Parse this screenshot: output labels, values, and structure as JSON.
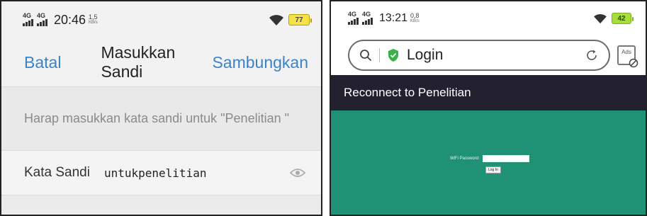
{
  "left_screen": {
    "status_bar": {
      "network_tags": [
        "4G",
        "4G"
      ],
      "time": "20:46",
      "speed_value": "1,5",
      "speed_unit": "KB/s",
      "battery_level": "77"
    },
    "dialog": {
      "cancel_label": "Batal",
      "title": "Masukkan Sandi",
      "connect_label": "Sambungkan",
      "message": "Harap masukkan kata sandi untuk \"Penelitian \"",
      "password_label": "Kata Sandi",
      "password_value": "untukpenelitian"
    }
  },
  "right_screen": {
    "status_bar": {
      "network_tags": [
        "4G",
        "4G"
      ],
      "time": "13:21",
      "speed_value": "0,8",
      "speed_unit": "KB/s",
      "battery_level": "42"
    },
    "browser": {
      "url_text": "Login",
      "ads_label": "Ads"
    },
    "portal": {
      "header": "Reconnect to Penelitian",
      "password_label": "WiFi Password:",
      "password_value": "",
      "login_button": "Log In",
      "accent_color": "#1f9276",
      "header_color": "#23202f"
    }
  },
  "icons": {
    "left": [
      "signal-icon",
      "wifi-icon",
      "battery-icon",
      "eye-icon"
    ],
    "right": [
      "signal-icon",
      "wifi-icon",
      "battery-icon",
      "search-icon",
      "shield-check-icon",
      "reload-icon",
      "ads-block-icon"
    ]
  }
}
